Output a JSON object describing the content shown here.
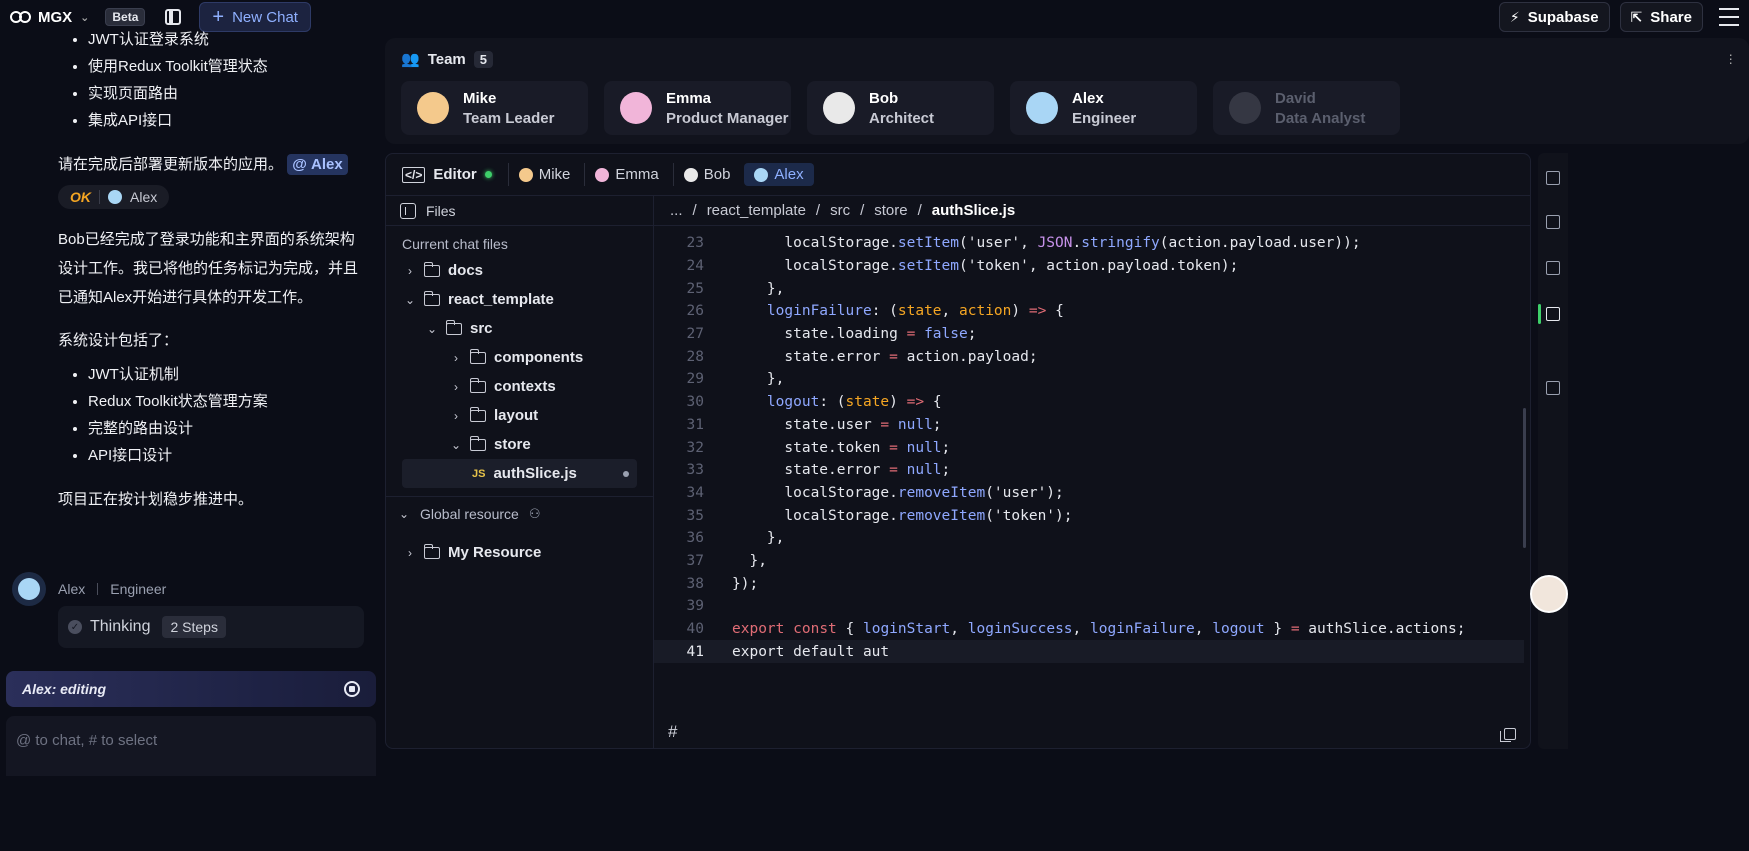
{
  "topbar": {
    "brand": "MGX",
    "beta": "Beta",
    "new_chat": "New Chat",
    "supabase": "Supabase",
    "share": "Share"
  },
  "chat": {
    "list1": [
      "JWT认证登录系统",
      "使用Redux Toolkit管理状态",
      "实现页面路由",
      "集成API接口"
    ],
    "request": "请在完成后部署更新版本的应用。",
    "mention": "@ Alex",
    "ok_label": "OK",
    "ok_agent": "Alex",
    "para1": "Bob已经完成了登录功能和主界面的系统架构设计工作。我已将他的任务标记为完成，并且已通知Alex开始进行具体的开发工作。",
    "para2": "系统设计包括了：",
    "list2": [
      "JWT认证机制",
      "Redux Toolkit状态管理方案",
      "完整的路由设计",
      "API接口设计"
    ],
    "para3": "项目正在按计划稳步推进中。",
    "agent_name": "Alex",
    "agent_role": "Engineer",
    "thinking": "Thinking",
    "steps": "2 Steps",
    "editing": "Alex: editing",
    "input_placeholder": "@ to chat, # to select"
  },
  "team": {
    "title": "Team",
    "count": "5",
    "members": [
      {
        "name": "Mike",
        "role": "Team Leader",
        "color": "#f4c98c"
      },
      {
        "name": "Emma",
        "role": "Product Manager",
        "color": "#f1b5d9"
      },
      {
        "name": "Bob",
        "role": "Architect",
        "color": "#e9e9e9"
      },
      {
        "name": "Alex",
        "role": "Engineer",
        "color": "#a9d6f5"
      },
      {
        "name": "David",
        "role": "Data Analyst",
        "color": "#6a6d78"
      }
    ]
  },
  "editor": {
    "label": "Editor",
    "tabs": [
      "Mike",
      "Emma",
      "Bob",
      "Alex"
    ],
    "active_tab": "Alex",
    "files_label": "Files",
    "current_files": "Current chat files",
    "tree": {
      "docs": "docs",
      "react_template": "react_template",
      "src": "src",
      "components": "components",
      "contexts": "contexts",
      "layout": "layout",
      "store": "store",
      "file": "authSlice.js",
      "file_badge": "JS"
    },
    "global_resource": "Global resource",
    "my_resource": "My Resource",
    "breadcrumb": [
      "...",
      "/",
      "react_template",
      "/",
      "src",
      "/",
      "store",
      "/",
      "authSlice.js"
    ],
    "hash": "#",
    "current_line": "41",
    "code": [
      {
        "n": "23",
        "html": "      localStorage.<span class=\"f\">setItem</span>('user', <span class=\"b\">JSON</span>.<span class=\"f\">stringify</span>(action.payload.user));"
      },
      {
        "n": "24",
        "html": "      localStorage.<span class=\"f\">setItem</span>('token', action.payload.token);"
      },
      {
        "n": "25",
        "html": "    },"
      },
      {
        "n": "26",
        "html": "    <span class=\"f\">loginFailure</span>: (<span class=\"p\">state</span>, <span class=\"p\">action</span>) <span class=\"o\">=&gt;</span> {"
      },
      {
        "n": "27",
        "html": "      state.loading <span class=\"o\">=</span> <span class=\"n\">false</span>;"
      },
      {
        "n": "28",
        "html": "      state.error <span class=\"o\">=</span> action.payload;"
      },
      {
        "n": "29",
        "html": "    },"
      },
      {
        "n": "30",
        "html": "    <span class=\"f\">logout</span>: (<span class=\"p\">state</span>) <span class=\"o\">=&gt;</span> {"
      },
      {
        "n": "31",
        "html": "      state.user <span class=\"o\">=</span> <span class=\"n\">null</span>;"
      },
      {
        "n": "32",
        "html": "      state.token <span class=\"o\">=</span> <span class=\"n\">null</span>;"
      },
      {
        "n": "33",
        "html": "      state.error <span class=\"o\">=</span> <span class=\"n\">null</span>;"
      },
      {
        "n": "34",
        "html": "      localStorage.<span class=\"f\">removeItem</span>('user');"
      },
      {
        "n": "35",
        "html": "      localStorage.<span class=\"f\">removeItem</span>('token');"
      },
      {
        "n": "36",
        "html": "    },"
      },
      {
        "n": "37",
        "html": "  },"
      },
      {
        "n": "38",
        "html": "});"
      },
      {
        "n": "39",
        "html": ""
      },
      {
        "n": "40",
        "html": "<span class=\"k\">export</span> <span class=\"k\">const</span> { <span class=\"f\">loginStart</span>, <span class=\"f\">loginSuccess</span>, <span class=\"f\">loginFailure</span>, <span class=\"f\">logout</span> } <span class=\"o\">=</span> authSlice.actions;"
      },
      {
        "n": "41",
        "html": "export default aut"
      }
    ]
  },
  "colors": {
    "accent": "#8fb0ff",
    "online": "#3ecf6a",
    "ok": "#f5a623"
  }
}
